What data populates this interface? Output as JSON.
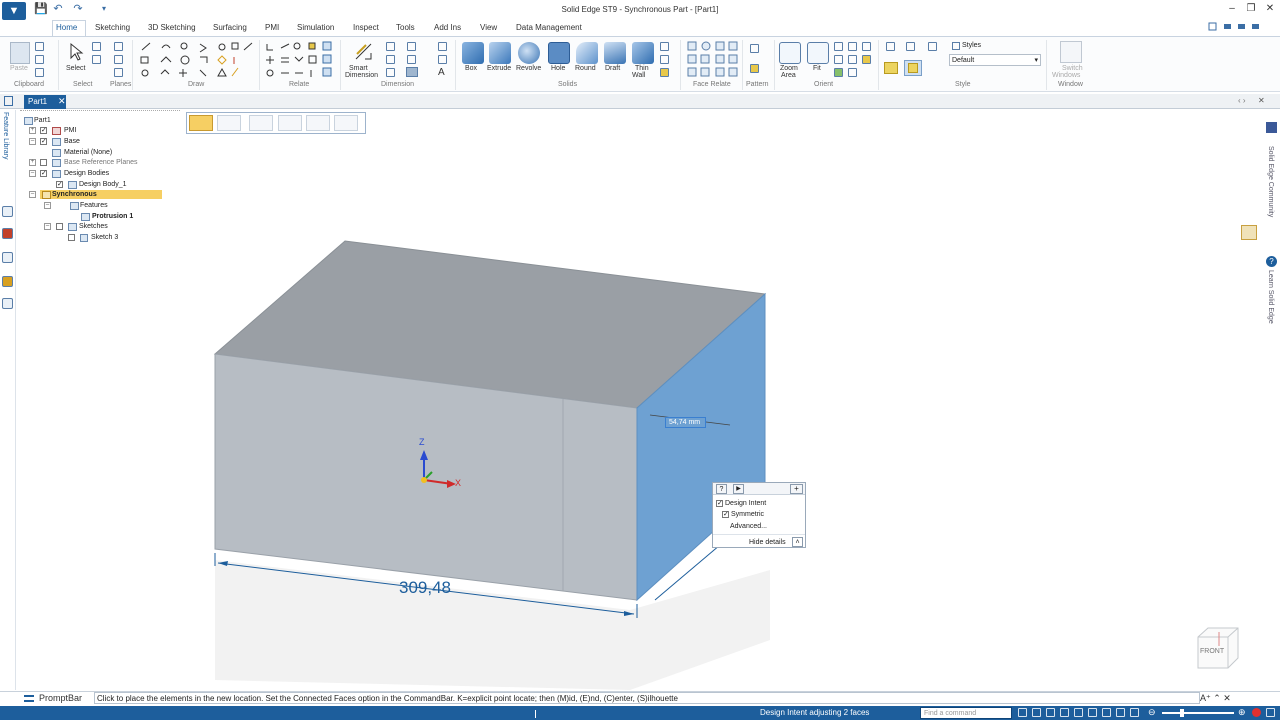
{
  "window": {
    "title": "Solid Edge ST9 - Synchronous Part - [Part1]",
    "minimize_icon": "minimize-icon",
    "restore_icon": "restore-icon",
    "close_icon": "close-icon"
  },
  "menu_tabs": [
    "Home",
    "Sketching",
    "3D Sketching",
    "Surfacing",
    "PMI",
    "Simulation",
    "Inspect",
    "Tools",
    "Add Ins",
    "View",
    "Data Management"
  ],
  "ribbon": {
    "groups": [
      "Clipboard",
      "Select",
      "Planes",
      "Draw",
      "Relate",
      "Dimension",
      "Solids",
      "Face Relate",
      "Pattern",
      "Orient",
      "Style",
      "Window"
    ],
    "paste": "Paste",
    "select": "Select",
    "smart_dimension": [
      "Smart",
      "Dimension"
    ],
    "solids": [
      "Box",
      "Extrude",
      "Revolve",
      "Hole",
      "Round",
      "Draft",
      "Thin"
    ],
    "thin_wall_2": "Wall",
    "zoom_area": [
      "Zoom",
      "Area"
    ],
    "fit": "Fit",
    "styles_label": "Styles",
    "styles_value": "Default",
    "switch_windows": [
      "Switch",
      "Windows"
    ]
  },
  "doc_tab": {
    "label": "Part1"
  },
  "left_tab": "Feature Library",
  "right_tabs": [
    "Solid Edge Community",
    "Learn Solid Edge"
  ],
  "tree": {
    "root": "Part1",
    "items": {
      "pmi": "PMI",
      "base": "Base",
      "material": "Material (None)",
      "base_planes": "Base Reference Planes",
      "design_bodies": "Design Bodies",
      "design_body": "Design Body_1",
      "synchronous": "Synchronous",
      "features": "Features",
      "protrusion": "Protrusion 1",
      "sketches": "Sketches",
      "sketch": "Sketch 3"
    }
  },
  "viewport": {
    "dimension_value": "309,48",
    "dynamic_input": "54,74 mm",
    "axis_z": "Z",
    "axis_x": "X",
    "view_cube": "FRONT"
  },
  "quicksilver": {
    "design_intent": "Design Intent",
    "symmetric": "Symmetric",
    "advanced": "Advanced...",
    "hide_details": "Hide details"
  },
  "prompt": {
    "label": "PromptBar",
    "message": "Click to place the elements in the new location.  Set the Connected Faces option in the CommandBar.  K=explicit point locate; then (M)id, (E)nd, (C)enter, (S)ilhouette"
  },
  "status": {
    "message": "Design Intent adjusting 2 faces",
    "find_placeholder": "Find a command"
  }
}
